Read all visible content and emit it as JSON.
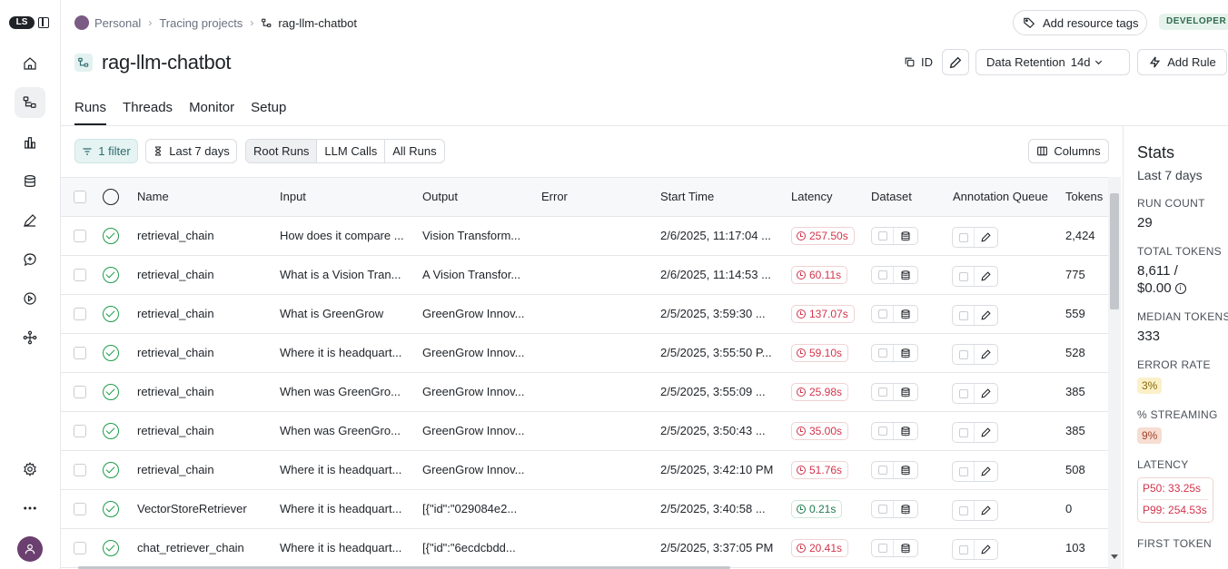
{
  "app": {
    "logo": "LS"
  },
  "breadcrumb": {
    "org": "Personal",
    "section": "Tracing projects",
    "project": "rag-llm-chatbot"
  },
  "header": {
    "resource_tags_label": "Add resource tags",
    "badge": "DEVELOPER",
    "title": "rag-llm-chatbot",
    "id_label": "ID",
    "retention_label": "Data Retention",
    "retention_value": "14d",
    "add_rule_label": "Add Rule"
  },
  "tabs": [
    "Runs",
    "Threads",
    "Monitor",
    "Setup"
  ],
  "toolbar": {
    "filter_label": "1 filter",
    "range_label": "Last 7 days",
    "segments": [
      "Root Runs",
      "LLM Calls",
      "All Runs"
    ],
    "columns_label": "Columns"
  },
  "table": {
    "headers": [
      "Name",
      "Input",
      "Output",
      "Error",
      "Start Time",
      "Latency",
      "Dataset",
      "Annotation Queue",
      "Tokens"
    ],
    "rows": [
      {
        "name": "retrieval_chain",
        "input": "How does it compare ...",
        "output": "Vision Transform...",
        "error": "",
        "start": "2/6/2025, 11:17:04 ...",
        "latency": "257.50s",
        "slow": true,
        "tokens": "2,424"
      },
      {
        "name": "retrieval_chain",
        "input": "What is a Vision Tran...",
        "output": "A Vision Transfor...",
        "error": "",
        "start": "2/6/2025, 11:14:53 ...",
        "latency": "60.11s",
        "slow": true,
        "tokens": "775"
      },
      {
        "name": "retrieval_chain",
        "input": "What is GreenGrow",
        "output": "GreenGrow Innov...",
        "error": "",
        "start": "2/5/2025, 3:59:30 ...",
        "latency": "137.07s",
        "slow": true,
        "tokens": "559"
      },
      {
        "name": "retrieval_chain",
        "input": "Where it is headquart...",
        "output": "GreenGrow Innov...",
        "error": "",
        "start": "2/5/2025, 3:55:50 P...",
        "latency": "59.10s",
        "slow": true,
        "tokens": "528"
      },
      {
        "name": "retrieval_chain",
        "input": "When was GreenGro...",
        "output": "GreenGrow Innov...",
        "error": "",
        "start": "2/5/2025, 3:55:09 ...",
        "latency": "25.98s",
        "slow": true,
        "tokens": "385"
      },
      {
        "name": "retrieval_chain",
        "input": "When was GreenGro...",
        "output": "GreenGrow Innov...",
        "error": "",
        "start": "2/5/2025, 3:50:43 ...",
        "latency": "35.00s",
        "slow": true,
        "tokens": "385"
      },
      {
        "name": "retrieval_chain",
        "input": "Where it is headquart...",
        "output": "GreenGrow Innov...",
        "error": "",
        "start": "2/5/2025, 3:42:10 PM",
        "latency": "51.76s",
        "slow": true,
        "tokens": "508"
      },
      {
        "name": "VectorStoreRetriever",
        "input": "Where it is headquart...",
        "output": "[{\"id\":\"029084e2...",
        "error": "",
        "start": "2/5/2025, 3:40:58 ...",
        "latency": "0.21s",
        "slow": false,
        "tokens": "0"
      },
      {
        "name": "chat_retriever_chain",
        "input": "Where it is headquart...",
        "output": "[{\"id\":\"6ecdcbdd...",
        "error": "",
        "start": "2/5/2025, 3:37:05 PM",
        "latency": "20.41s",
        "slow": true,
        "tokens": "103"
      }
    ]
  },
  "stats": {
    "title": "Stats",
    "period": "Last 7 days",
    "run_count_label": "RUN COUNT",
    "run_count": "29",
    "total_tokens_label": "TOTAL TOKENS",
    "total_tokens": "8,611 /",
    "total_cost": "$0.00",
    "median_tokens_label": "MEDIAN TOKENS",
    "median_tokens": "333",
    "error_rate_label": "ERROR RATE",
    "error_rate": "3%",
    "streaming_label": "% STREAMING",
    "streaming": "9%",
    "latency_label": "LATENCY",
    "p50": "P50: 33.25s",
    "p99": "P99: 254.53s",
    "first_token_label": "FIRST TOKEN"
  },
  "colors": {
    "accent": "#2c6c6c",
    "success": "#1f9d4a",
    "danger": "#d1344b"
  }
}
